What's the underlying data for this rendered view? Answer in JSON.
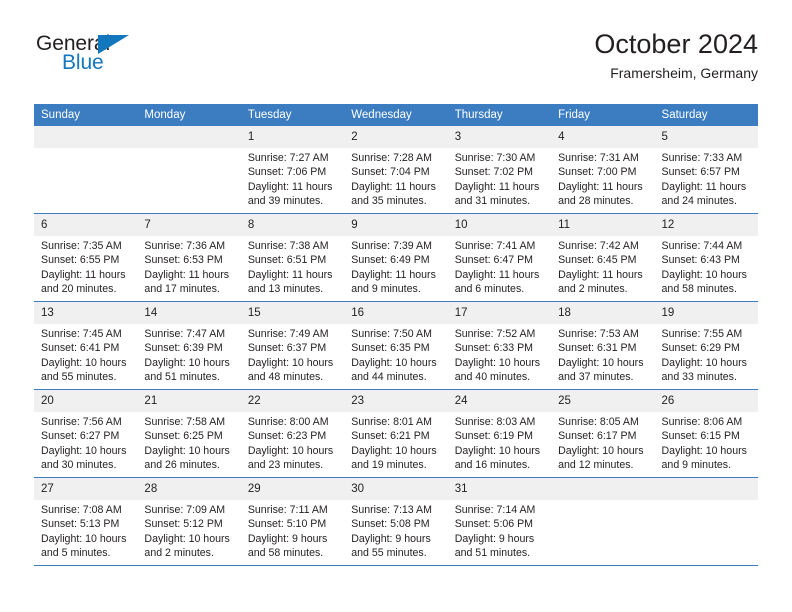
{
  "brand": {
    "name_top": "General",
    "name_bottom": "Blue",
    "triangle_icon": "triangle-icon",
    "accent_color": "#1277bc"
  },
  "header": {
    "title": "October 2024",
    "subtitle": "Framersheim, Germany"
  },
  "calendar": {
    "header_color": "#3b7dc0",
    "daynum_band_color": "#f0f0f0",
    "weekday_headers": [
      "Sunday",
      "Monday",
      "Tuesday",
      "Wednesday",
      "Thursday",
      "Friday",
      "Saturday"
    ],
    "weeks": [
      [
        {
          "day": "",
          "sunrise": "",
          "sunset": "",
          "daylight": "",
          "daylight2": ""
        },
        {
          "day": "",
          "sunrise": "",
          "sunset": "",
          "daylight": "",
          "daylight2": ""
        },
        {
          "day": "1",
          "sunrise": "Sunrise: 7:27 AM",
          "sunset": "Sunset: 7:06 PM",
          "daylight": "Daylight: 11 hours",
          "daylight2": "and 39 minutes."
        },
        {
          "day": "2",
          "sunrise": "Sunrise: 7:28 AM",
          "sunset": "Sunset: 7:04 PM",
          "daylight": "Daylight: 11 hours",
          "daylight2": "and 35 minutes."
        },
        {
          "day": "3",
          "sunrise": "Sunrise: 7:30 AM",
          "sunset": "Sunset: 7:02 PM",
          "daylight": "Daylight: 11 hours",
          "daylight2": "and 31 minutes."
        },
        {
          "day": "4",
          "sunrise": "Sunrise: 7:31 AM",
          "sunset": "Sunset: 7:00 PM",
          "daylight": "Daylight: 11 hours",
          "daylight2": "and 28 minutes."
        },
        {
          "day": "5",
          "sunrise": "Sunrise: 7:33 AM",
          "sunset": "Sunset: 6:57 PM",
          "daylight": "Daylight: 11 hours",
          "daylight2": "and 24 minutes."
        }
      ],
      [
        {
          "day": "6",
          "sunrise": "Sunrise: 7:35 AM",
          "sunset": "Sunset: 6:55 PM",
          "daylight": "Daylight: 11 hours",
          "daylight2": "and 20 minutes."
        },
        {
          "day": "7",
          "sunrise": "Sunrise: 7:36 AM",
          "sunset": "Sunset: 6:53 PM",
          "daylight": "Daylight: 11 hours",
          "daylight2": "and 17 minutes."
        },
        {
          "day": "8",
          "sunrise": "Sunrise: 7:38 AM",
          "sunset": "Sunset: 6:51 PM",
          "daylight": "Daylight: 11 hours",
          "daylight2": "and 13 minutes."
        },
        {
          "day": "9",
          "sunrise": "Sunrise: 7:39 AM",
          "sunset": "Sunset: 6:49 PM",
          "daylight": "Daylight: 11 hours",
          "daylight2": "and 9 minutes."
        },
        {
          "day": "10",
          "sunrise": "Sunrise: 7:41 AM",
          "sunset": "Sunset: 6:47 PM",
          "daylight": "Daylight: 11 hours",
          "daylight2": "and 6 minutes."
        },
        {
          "day": "11",
          "sunrise": "Sunrise: 7:42 AM",
          "sunset": "Sunset: 6:45 PM",
          "daylight": "Daylight: 11 hours",
          "daylight2": "and 2 minutes."
        },
        {
          "day": "12",
          "sunrise": "Sunrise: 7:44 AM",
          "sunset": "Sunset: 6:43 PM",
          "daylight": "Daylight: 10 hours",
          "daylight2": "and 58 minutes."
        }
      ],
      [
        {
          "day": "13",
          "sunrise": "Sunrise: 7:45 AM",
          "sunset": "Sunset: 6:41 PM",
          "daylight": "Daylight: 10 hours",
          "daylight2": "and 55 minutes."
        },
        {
          "day": "14",
          "sunrise": "Sunrise: 7:47 AM",
          "sunset": "Sunset: 6:39 PM",
          "daylight": "Daylight: 10 hours",
          "daylight2": "and 51 minutes."
        },
        {
          "day": "15",
          "sunrise": "Sunrise: 7:49 AM",
          "sunset": "Sunset: 6:37 PM",
          "daylight": "Daylight: 10 hours",
          "daylight2": "and 48 minutes."
        },
        {
          "day": "16",
          "sunrise": "Sunrise: 7:50 AM",
          "sunset": "Sunset: 6:35 PM",
          "daylight": "Daylight: 10 hours",
          "daylight2": "and 44 minutes."
        },
        {
          "day": "17",
          "sunrise": "Sunrise: 7:52 AM",
          "sunset": "Sunset: 6:33 PM",
          "daylight": "Daylight: 10 hours",
          "daylight2": "and 40 minutes."
        },
        {
          "day": "18",
          "sunrise": "Sunrise: 7:53 AM",
          "sunset": "Sunset: 6:31 PM",
          "daylight": "Daylight: 10 hours",
          "daylight2": "and 37 minutes."
        },
        {
          "day": "19",
          "sunrise": "Sunrise: 7:55 AM",
          "sunset": "Sunset: 6:29 PM",
          "daylight": "Daylight: 10 hours",
          "daylight2": "and 33 minutes."
        }
      ],
      [
        {
          "day": "20",
          "sunrise": "Sunrise: 7:56 AM",
          "sunset": "Sunset: 6:27 PM",
          "daylight": "Daylight: 10 hours",
          "daylight2": "and 30 minutes."
        },
        {
          "day": "21",
          "sunrise": "Sunrise: 7:58 AM",
          "sunset": "Sunset: 6:25 PM",
          "daylight": "Daylight: 10 hours",
          "daylight2": "and 26 minutes."
        },
        {
          "day": "22",
          "sunrise": "Sunrise: 8:00 AM",
          "sunset": "Sunset: 6:23 PM",
          "daylight": "Daylight: 10 hours",
          "daylight2": "and 23 minutes."
        },
        {
          "day": "23",
          "sunrise": "Sunrise: 8:01 AM",
          "sunset": "Sunset: 6:21 PM",
          "daylight": "Daylight: 10 hours",
          "daylight2": "and 19 minutes."
        },
        {
          "day": "24",
          "sunrise": "Sunrise: 8:03 AM",
          "sunset": "Sunset: 6:19 PM",
          "daylight": "Daylight: 10 hours",
          "daylight2": "and 16 minutes."
        },
        {
          "day": "25",
          "sunrise": "Sunrise: 8:05 AM",
          "sunset": "Sunset: 6:17 PM",
          "daylight": "Daylight: 10 hours",
          "daylight2": "and 12 minutes."
        },
        {
          "day": "26",
          "sunrise": "Sunrise: 8:06 AM",
          "sunset": "Sunset: 6:15 PM",
          "daylight": "Daylight: 10 hours",
          "daylight2": "and 9 minutes."
        }
      ],
      [
        {
          "day": "27",
          "sunrise": "Sunrise: 7:08 AM",
          "sunset": "Sunset: 5:13 PM",
          "daylight": "Daylight: 10 hours",
          "daylight2": "and 5 minutes."
        },
        {
          "day": "28",
          "sunrise": "Sunrise: 7:09 AM",
          "sunset": "Sunset: 5:12 PM",
          "daylight": "Daylight: 10 hours",
          "daylight2": "and 2 minutes."
        },
        {
          "day": "29",
          "sunrise": "Sunrise: 7:11 AM",
          "sunset": "Sunset: 5:10 PM",
          "daylight": "Daylight: 9 hours",
          "daylight2": "and 58 minutes."
        },
        {
          "day": "30",
          "sunrise": "Sunrise: 7:13 AM",
          "sunset": "Sunset: 5:08 PM",
          "daylight": "Daylight: 9 hours",
          "daylight2": "and 55 minutes."
        },
        {
          "day": "31",
          "sunrise": "Sunrise: 7:14 AM",
          "sunset": "Sunset: 5:06 PM",
          "daylight": "Daylight: 9 hours",
          "daylight2": "and 51 minutes."
        },
        {
          "day": "",
          "sunrise": "",
          "sunset": "",
          "daylight": "",
          "daylight2": ""
        },
        {
          "day": "",
          "sunrise": "",
          "sunset": "",
          "daylight": "",
          "daylight2": ""
        }
      ]
    ]
  }
}
